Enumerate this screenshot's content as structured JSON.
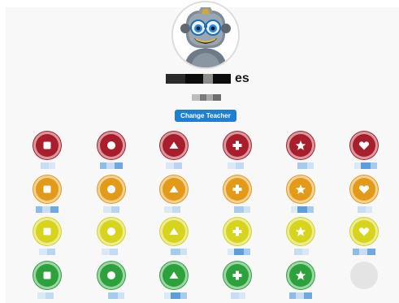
{
  "colors": {
    "red": "#a81e2c",
    "orange": "#e29a18",
    "yellow": "#d6d41c",
    "green": "#2ca13c",
    "accent": "#1e7fd3",
    "empty": "#e4e4e4"
  },
  "teacher": {
    "avatar": "robot-avatar",
    "name_visible_suffix": "es",
    "change_button_label": "Change Teacher"
  },
  "icon_grid": {
    "shapes": [
      "square",
      "circle",
      "triangle",
      "plus",
      "star",
      "heart"
    ],
    "rows": [
      {
        "color": "red",
        "items": [
          "square",
          "circle",
          "triangle",
          "plus",
          "star",
          "heart"
        ]
      },
      {
        "color": "orange",
        "items": [
          "square",
          "circle",
          "triangle",
          "plus",
          "star",
          "heart"
        ]
      },
      {
        "color": "yellow",
        "items": [
          "square",
          "circle",
          "triangle",
          "plus",
          "star",
          "heart"
        ]
      },
      {
        "color": "green",
        "items": [
          "square",
          "circle",
          "triangle",
          "plus",
          "star",
          "empty"
        ]
      }
    ]
  }
}
